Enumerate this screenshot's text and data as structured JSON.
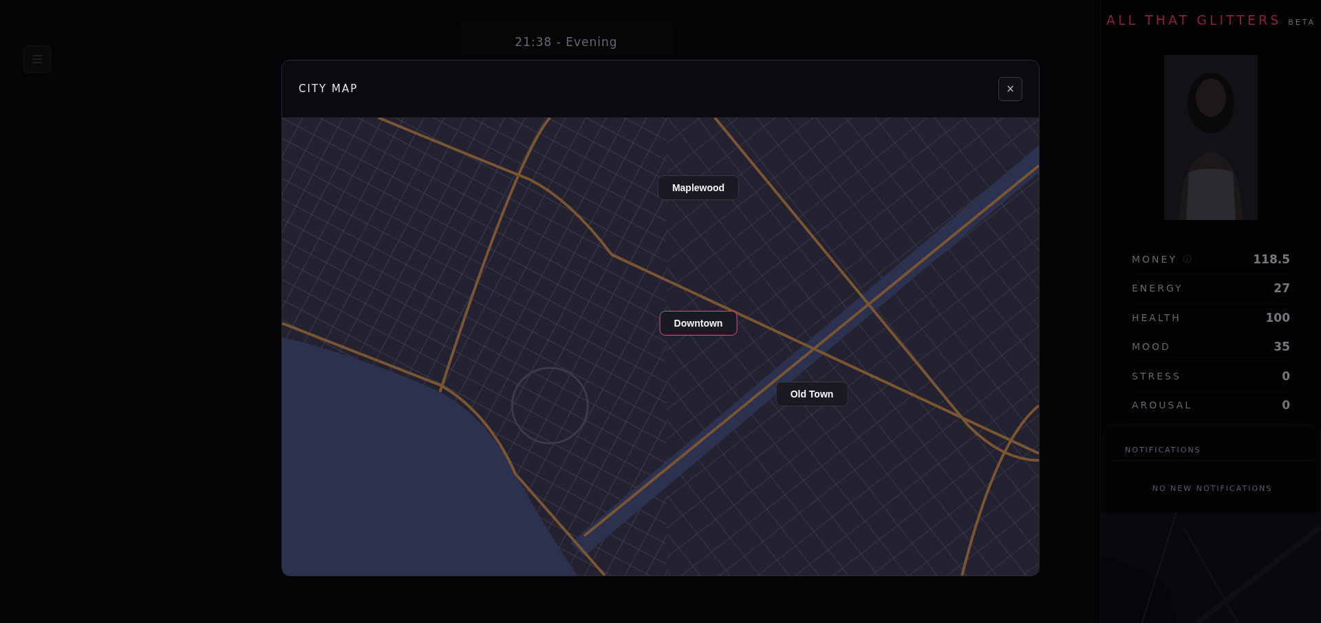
{
  "header": {
    "time": "21:38 - Evening"
  },
  "sidebar": {
    "title": "ALL THAT GLITTERS",
    "badge": "BETA",
    "stats": [
      {
        "label": "MONEY",
        "info": true,
        "value": "118.5"
      },
      {
        "label": "ENERGY",
        "info": false,
        "value": "27"
      },
      {
        "label": "HEALTH",
        "info": false,
        "value": "100"
      },
      {
        "label": "MOOD",
        "info": false,
        "value": "35"
      },
      {
        "label": "STRESS",
        "info": false,
        "value": "0"
      },
      {
        "label": "AROUSAL",
        "info": false,
        "value": "0"
      }
    ],
    "notifications": {
      "title": "NOTIFICATIONS",
      "empty": "NO NEW NOTIFICATIONS"
    }
  },
  "modal": {
    "title": "CITY MAP",
    "close": "×",
    "locations": [
      {
        "name": "Maplewood",
        "selected": false
      },
      {
        "name": "Downtown",
        "selected": true
      },
      {
        "name": "Old Town",
        "selected": false
      }
    ]
  }
}
